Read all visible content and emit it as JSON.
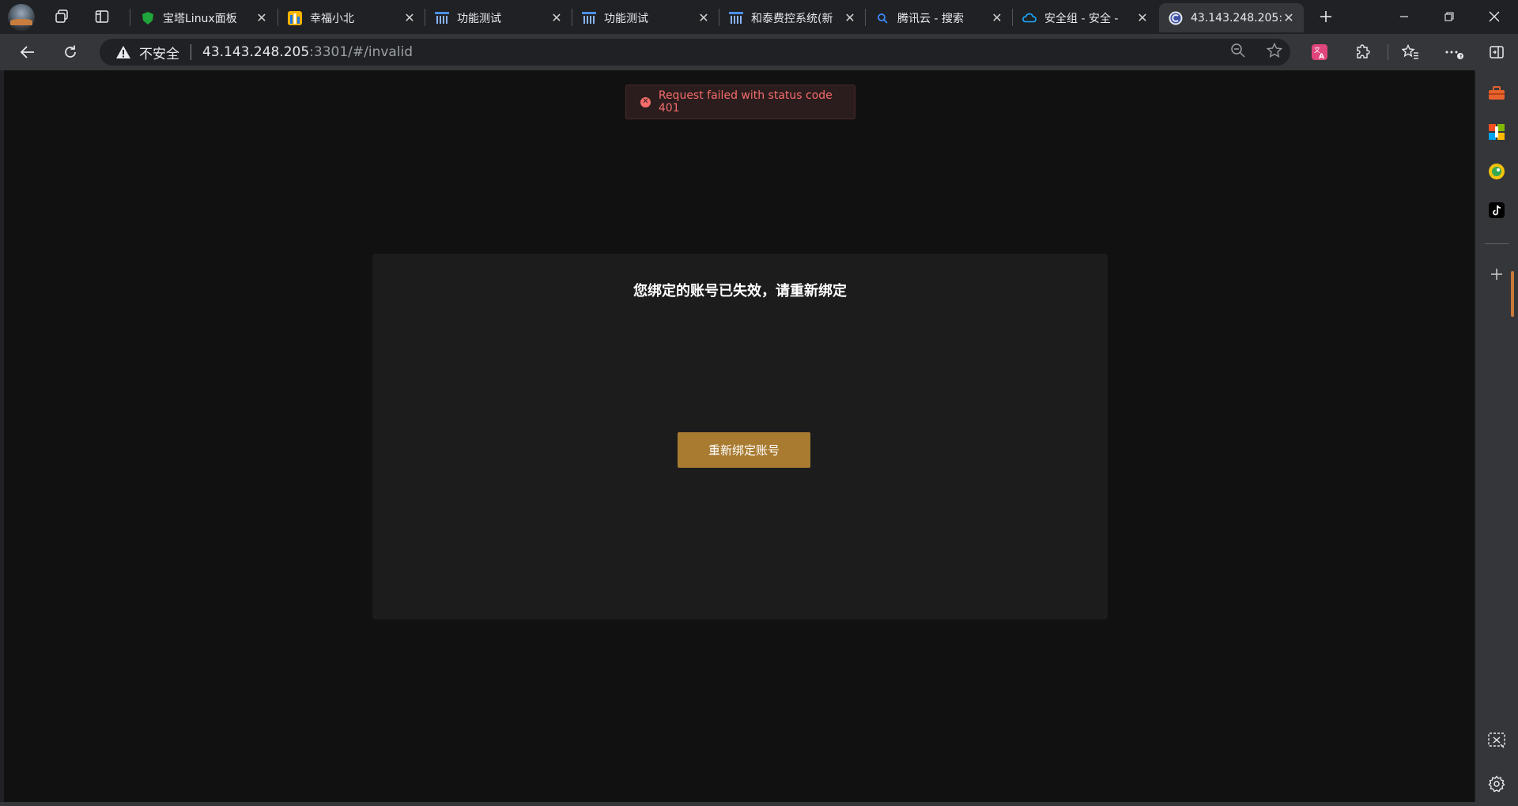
{
  "browser": {
    "tabs": [
      {
        "title": "宝塔Linux面板",
        "favicon": "baota-shield-icon",
        "favicon_color": "#20a53a",
        "active": false
      },
      {
        "title": "幸福小北",
        "favicon": "building-icon",
        "favicon_color": "#f4b400",
        "active": false
      },
      {
        "title": "功能测试",
        "favicon": "chart-icon",
        "favicon_color": "#4a8fe7",
        "active": false
      },
      {
        "title": "功能测试",
        "favicon": "chart-icon",
        "favicon_color": "#4a8fe7",
        "active": false
      },
      {
        "title": "和泰费控系统(新",
        "favicon": "chart-icon",
        "favicon_color": "#4a8fe7",
        "active": false
      },
      {
        "title": "腾讯云 - 搜索",
        "favicon": "search-icon",
        "favicon_color": "#3b8cff",
        "active": false
      },
      {
        "title": "安全组 - 安全 - ",
        "favicon": "cloud-icon",
        "favicon_color": "#19a9ff",
        "active": false
      },
      {
        "title": "43.143.248.205:3",
        "favicon": "c-logo-icon",
        "favicon_color": "#3b4fa8",
        "active": true
      }
    ],
    "address": {
      "security_label": "不安全",
      "host": "43.143.248.205",
      "rest": ":3301/#/invalid"
    },
    "colors": {
      "chrome_dark": "#202124",
      "toolbar": "#35363a",
      "accent_orange": "#c7793a"
    }
  },
  "page": {
    "toast": {
      "message": "Request failed with status code 401",
      "icon": "error-circle-icon",
      "color": "#f56c6c"
    },
    "card": {
      "title": "您绑定的账号已失效，请重新绑定",
      "button_label": "重新绑定账号",
      "button_color": "#a87b30"
    }
  },
  "sidebar": {
    "items": [
      "toolbox-icon",
      "office-icon",
      "games-icon",
      "tiktok-icon",
      "add-icon"
    ],
    "bottom_items": [
      "screenshot-icon",
      "settings-icon"
    ]
  }
}
